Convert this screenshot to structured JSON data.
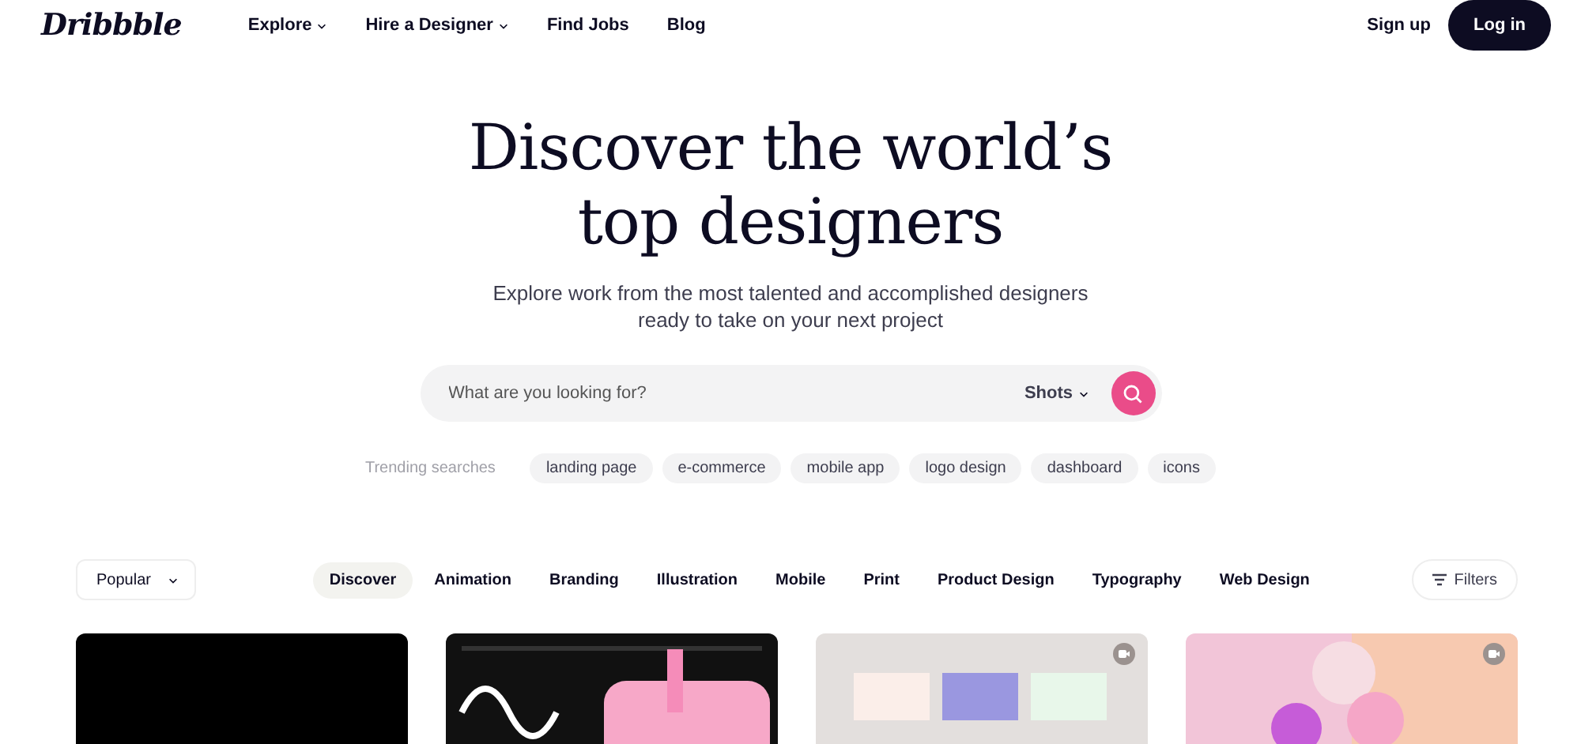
{
  "nav": {
    "logo": "Dribbble",
    "links": [
      {
        "label": "Explore",
        "dropdown": true
      },
      {
        "label": "Hire a Designer",
        "dropdown": true
      },
      {
        "label": "Find Jobs",
        "dropdown": false
      },
      {
        "label": "Blog",
        "dropdown": false
      }
    ],
    "sign_up": "Sign up",
    "log_in": "Log in"
  },
  "hero": {
    "title_lines": [
      "Discover the world’s",
      "top designers"
    ],
    "subtitle_lines": [
      "Explore work from the most talented and accomplished designers",
      "ready to take on your next project"
    ]
  },
  "search": {
    "placeholder": "What are you looking for?",
    "scope": "Shots"
  },
  "trending": {
    "label": "Trending searches",
    "tags": [
      "landing page",
      "e-commerce",
      "mobile app",
      "logo design",
      "dashboard",
      "icons"
    ]
  },
  "filters": {
    "sort": "Popular",
    "categories": [
      {
        "label": "Discover",
        "selected": true
      },
      {
        "label": "Animation",
        "selected": false
      },
      {
        "label": "Branding",
        "selected": false
      },
      {
        "label": "Illustration",
        "selected": false
      },
      {
        "label": "Mobile",
        "selected": false
      },
      {
        "label": "Print",
        "selected": false
      },
      {
        "label": "Product Design",
        "selected": false
      },
      {
        "label": "Typography",
        "selected": false
      },
      {
        "label": "Web Design",
        "selected": false
      }
    ],
    "filters_button": "Filters"
  },
  "shots": [
    {
      "kind": "picture",
      "video": false
    },
    {
      "kind": "picture",
      "video": false
    },
    {
      "kind": "picture",
      "video": true
    },
    {
      "kind": "picture",
      "video": true
    }
  ]
}
